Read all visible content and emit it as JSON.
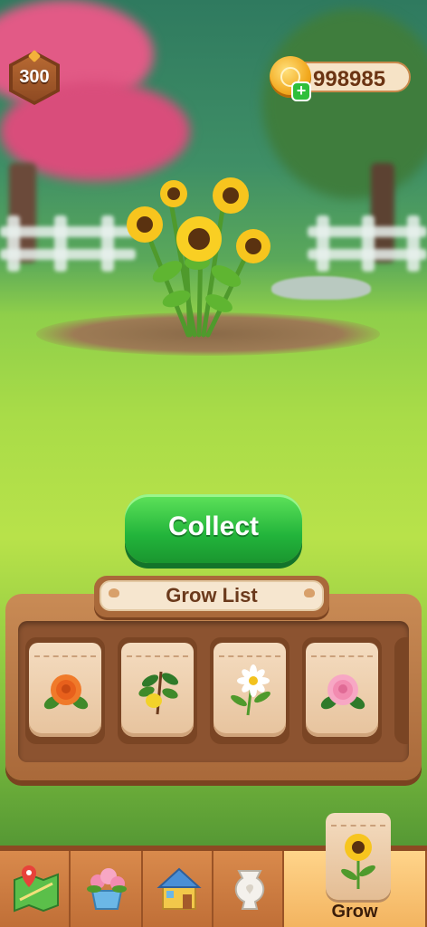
{
  "hud": {
    "level": "300",
    "coins": "998985",
    "add_coins_symbol": "+"
  },
  "actions": {
    "collect_label": "Collect"
  },
  "grow_list": {
    "title": "Grow List",
    "seeds": [
      {
        "icon": "orange-rose-icon"
      },
      {
        "icon": "lemon-branch-icon"
      },
      {
        "icon": "daisy-icon"
      },
      {
        "icon": "pink-rose-icon"
      }
    ]
  },
  "nav": {
    "tabs": [
      {
        "icon": "map-icon"
      },
      {
        "icon": "flower-pot-icon"
      },
      {
        "icon": "house-icon"
      },
      {
        "icon": "vase-icon"
      },
      {
        "icon": "sunflower-seed-icon",
        "label": "Grow",
        "active": true
      }
    ]
  },
  "colors": {
    "collect_green": "#22b43b",
    "wood": "#a9693a",
    "coin_gold": "#f2a91f"
  }
}
